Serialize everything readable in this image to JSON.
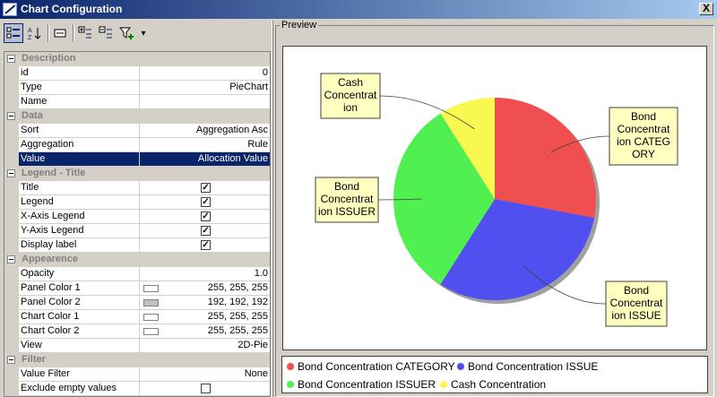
{
  "window": {
    "title": "Chart Configuration",
    "close_label": "X"
  },
  "toolbar": {
    "buttons": [
      {
        "icon": "categorized-icon"
      },
      {
        "icon": "sort-az-icon"
      },
      {
        "icon": "property-pages-icon"
      },
      {
        "icon": "expand-icon"
      },
      {
        "icon": "collapse-icon"
      },
      {
        "icon": "filter-add-icon"
      },
      {
        "icon": "dropdown-arrow-icon",
        "glyph": "▾"
      }
    ]
  },
  "properties": {
    "description": {
      "label": "Description",
      "id_label": "id",
      "id_value": "0",
      "type_label": "Type",
      "type_value": "PieChart",
      "name_label": "Name",
      "name_value": ""
    },
    "data": {
      "label": "Data",
      "sort_label": "Sort",
      "sort_value": "Aggregation Asc",
      "aggregation_label": "Aggregation",
      "aggregation_value": "Rule",
      "value_label": "Value",
      "value_value": "Allocation Value"
    },
    "legend_title": {
      "label": "Legend - Title",
      "title_label": "Title",
      "legend_label": "Legend",
      "xaxis_label": "X-Axis Legend",
      "yaxis_label": "Y-Axis Legend",
      "display_label": "Display label",
      "check": "✓"
    },
    "appearance": {
      "label": "Appearence",
      "opacity_label": "Opacity",
      "opacity_value": "1.0",
      "panel1_label": "Panel Color 1",
      "panel1_value": "255, 255, 255",
      "panel1_color": "#ffffff",
      "panel2_label": "Panel Color 2",
      "panel2_value": "192, 192, 192",
      "panel2_color": "#c0c0c0",
      "chart1_label": "Chart Color 1",
      "chart1_value": "255, 255, 255",
      "chart1_color": "#ffffff",
      "chart2_label": "Chart Color 2",
      "chart2_value": "255, 255, 255",
      "chart2_color": "#ffffff",
      "view_label": "View",
      "view_value": "2D-Pie"
    },
    "filter": {
      "label": "Filter",
      "value_filter_label": "Value Filter",
      "value_filter_value": "None",
      "exclude_label": "Exclude empty values"
    }
  },
  "preview": {
    "label": "Preview"
  },
  "chart_data": {
    "type": "pie",
    "categories": [
      "Bond Concentration CATEGORY",
      "Bond Concentration ISSUE",
      "Bond Concentration ISSUER",
      "Cash Concentration"
    ],
    "values": [
      28,
      31,
      32,
      9
    ],
    "colors": [
      "#f04f4f",
      "#5050f0",
      "#50f050",
      "#f8f850"
    ],
    "callouts": [
      {
        "lines": [
          "Bond",
          "Concentrat",
          "ion CATEG",
          "ORY"
        ]
      },
      {
        "lines": [
          "Bond",
          "Concentrat",
          "ion ISSUE"
        ]
      },
      {
        "lines": [
          "Bond",
          "Concentrat",
          "ion ISSUER"
        ]
      },
      {
        "lines": [
          "Cash",
          "Concentrat",
          "ion"
        ]
      }
    ],
    "legend": [
      "Bond Concentration CATEGORY",
      "Bond Concentration ISSUE",
      "Bond Concentration ISSUER",
      "Cash Concentration"
    ]
  }
}
